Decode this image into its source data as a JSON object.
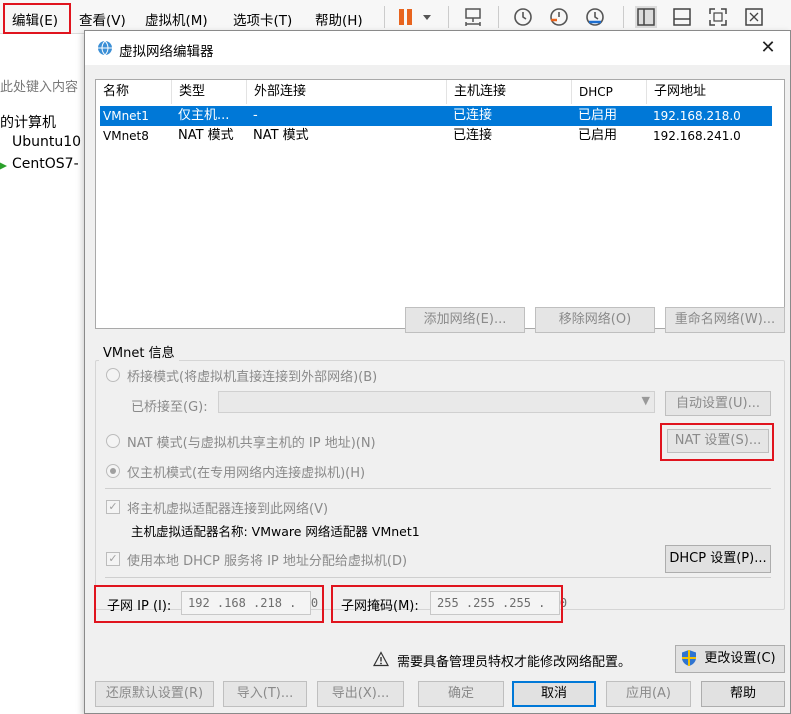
{
  "menubar": {
    "items": [
      "编辑(E)",
      "查看(V)",
      "虚拟机(M)",
      "选项卡(T)",
      "帮助(H)"
    ]
  },
  "toolbar": {
    "icons": [
      "pause-icon",
      "dropdown-icon",
      "network-icon",
      "snapshot-icon",
      "revert-snapshot-icon",
      "manage-snapshots-icon",
      "view-normal-icon",
      "view-console-icon",
      "fullscreen-icon",
      "unity-icon"
    ]
  },
  "library": {
    "search_placeholder": "此处键入内容",
    "items": [
      "我的计算机",
      "Ubuntu10",
      "CentOS7-"
    ]
  },
  "dialog": {
    "title": "虚拟网络编辑器",
    "close": "✕"
  },
  "netlist": {
    "headers": [
      "名称",
      "类型",
      "外部连接",
      "主机连接",
      "DHCP",
      "子网地址"
    ],
    "rows": [
      [
        "VMnet1",
        "仅主机...",
        "-",
        "已连接",
        "已启用",
        "192.168.218.0"
      ],
      [
        "VMnet8",
        "NAT 模式",
        "NAT 模式",
        "已连接",
        "已启用",
        "192.168.241.0"
      ]
    ]
  },
  "list_buttons": {
    "add": "添加网络(E)...",
    "remove": "移除网络(O)",
    "rename": "重命名网络(W)..."
  },
  "vmnet_info": {
    "title": "VMnet 信息",
    "bridged": "桥接模式(将虚拟机直接连接到外部网络)(B)",
    "bridged_to_label": "已桥接至(G):",
    "auto_settings": "自动设置(U)...",
    "nat": "NAT 模式(与虚拟机共享主机的 IP 地址)(N)",
    "nat_settings": "NAT 设置(S)...",
    "host_only": "仅主机模式(在专用网络内连接虚拟机)(H)",
    "connect_adapter": "将主机虚拟适配器连接到此网络(V)",
    "adapter_name": "主机虚拟适配器名称: VMware 网络适配器 VMnet1",
    "use_dhcp": "使用本地 DHCP 服务将 IP 地址分配给虚拟机(D)",
    "dhcp_settings": "DHCP 设置(P)...",
    "subnet_ip_label": "子网 IP (I):",
    "subnet_ip": "192 .168 .218 .  0",
    "subnet_mask_label": "子网掩码(M):",
    "subnet_mask": "255 .255 .255 .  0"
  },
  "footer": {
    "warning": "需要具备管理员特权才能修改网络配置。",
    "change_settings": "更改设置(C)",
    "restore_defaults": "还原默认设置(R)",
    "import": "导入(T)...",
    "export": "导出(X)...",
    "ok": "确定",
    "cancel": "取消",
    "apply": "应用(A)",
    "help": "帮助"
  },
  "colors": {
    "selection": "#0078d7",
    "highlight_box": "#e0141e",
    "pause_orange": "#e8641e"
  }
}
